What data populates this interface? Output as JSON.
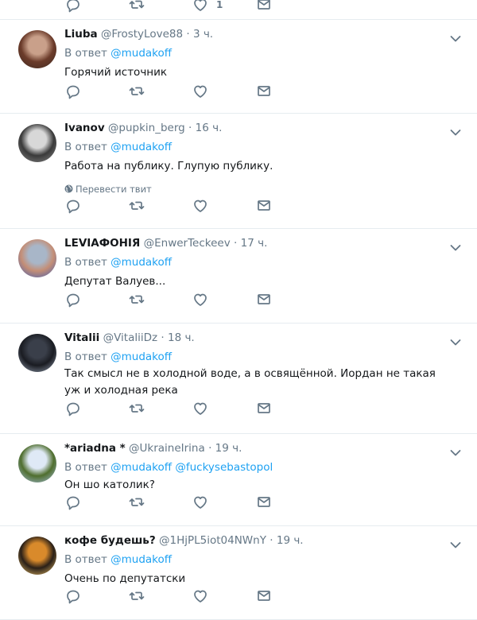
{
  "top_like_count": "1",
  "tweets": [
    {
      "name": "Liuba",
      "handle": "@FrostyLove88",
      "time": "3 ч.",
      "reply_prefix": "В ответ",
      "mentions": [
        "@mudakoff"
      ],
      "text": "Горячий источник",
      "avatar_colors": [
        "#6b3b2a",
        "#c9a08a",
        "#3e2a22"
      ]
    },
    {
      "name": "Ivanov",
      "handle": "@pupkin_berg",
      "time": "16 ч.",
      "reply_prefix": "В ответ",
      "mentions": [
        "@mudakoff"
      ],
      "text": "Работа на публику. Глупую публику.",
      "translate": "Перевести твит",
      "avatar_colors": [
        "#3a3a3a",
        "#d8d8d8",
        "#8a8a8a"
      ]
    },
    {
      "name": "LEVIАФОНІЯ",
      "handle": "@EnwerTeckeev",
      "time": "17 ч.",
      "reply_prefix": "В ответ",
      "mentions": [
        "@mudakoff"
      ],
      "text": "Депутат Валуев...",
      "avatar_colors": [
        "#c48e76",
        "#a8b6c8",
        "#3b5bb5"
      ]
    },
    {
      "name": "Vitalii",
      "handle": "@VitaliiDz",
      "time": "18 ч.",
      "reply_prefix": "В ответ",
      "mentions": [
        "@mudakoff"
      ],
      "text": "Так смысл не в холодной воде, а в освящённой. Иордан не такая уж и холодная река",
      "avatar_colors": [
        "#1a1c22",
        "#3a3f4a",
        "#9aa6b8"
      ]
    },
    {
      "name": "*ariadna *",
      "handle": "@UkraineIrina",
      "time": "19 ч.",
      "reply_prefix": "В ответ",
      "mentions": [
        "@mudakoff",
        "@fuckysebastopol"
      ],
      "text": "Он шо католик?",
      "avatar_colors": [
        "#4f6e2e",
        "#dfe9f6",
        "#a9c2e6"
      ]
    },
    {
      "name": "кофе будешь?",
      "handle": "@1HjPL5iot04NWnY",
      "time": "19 ч.",
      "reply_prefix": "В ответ",
      "mentions": [
        "@mudakoff"
      ],
      "text": "Очень по депутатски",
      "avatar_colors": [
        "#2a2018",
        "#d98a2b",
        "#f1c46a"
      ]
    }
  ]
}
